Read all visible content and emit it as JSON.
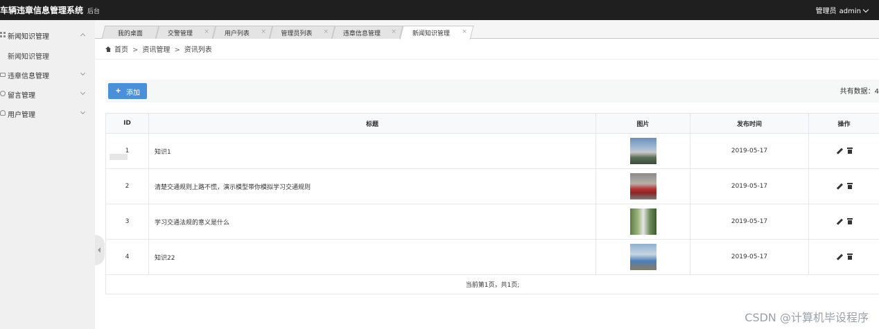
{
  "header": {
    "app_title": "车辆违章信息管理系统",
    "app_subtitle": "后台",
    "user_role": "管理员",
    "user_name": "admin"
  },
  "sidebar": {
    "items": [
      {
        "label": "新闻知识管理",
        "icon": "grid-icon",
        "expanded": true
      },
      {
        "label": "新闻知识管理",
        "sub": true
      },
      {
        "label": "违章信息管理",
        "icon": "lock-icon",
        "expanded": false
      },
      {
        "label": "留言管理",
        "icon": "message-icon",
        "expanded": false
      },
      {
        "label": "用户管理",
        "icon": "user-icon",
        "expanded": false
      }
    ]
  },
  "tabs": [
    {
      "label": "我的桌面",
      "closable": false
    },
    {
      "label": "交警管理",
      "closable": true
    },
    {
      "label": "用户列表",
      "closable": true
    },
    {
      "label": "管理员列表",
      "closable": true
    },
    {
      "label": "违章信息管理",
      "closable": true
    },
    {
      "label": "新闻知识管理",
      "closable": true,
      "active": true
    }
  ],
  "close_glyph": "×",
  "breadcrumb": {
    "home": "首页",
    "sep": ">",
    "level1": "资讯管理",
    "level2": "资讯列表"
  },
  "toolbar": {
    "add_plus": "+",
    "add_label": "添加",
    "total_label": "共有数据：4"
  },
  "table": {
    "columns": [
      "ID",
      "标题",
      "图片",
      "发布时间",
      "操作"
    ],
    "rows": [
      {
        "id": "1",
        "title": "知识1",
        "date": "2019-05-17",
        "image": "thumbnail-image"
      },
      {
        "id": "2",
        "title": "清楚交通规则上路不慌，演示模型带你模拟学习交通规则",
        "date": "2019-05-17",
        "image": "thumbnail-image"
      },
      {
        "id": "3",
        "title": "学习交通法规的意义是什么",
        "date": "2019-05-17",
        "image": "thumbnail-image"
      },
      {
        "id": "4",
        "title": "知识22",
        "date": "2019-05-17",
        "image": "thumbnail-image"
      }
    ],
    "pager_text": "当前第1页，共1页;"
  },
  "watermark": "CSDN @计算机毕设程序",
  "colors": {
    "header_bg": "#1f1f1f",
    "sidebar_bg": "#f0f0f0",
    "primary_button": "#4a90d9"
  }
}
